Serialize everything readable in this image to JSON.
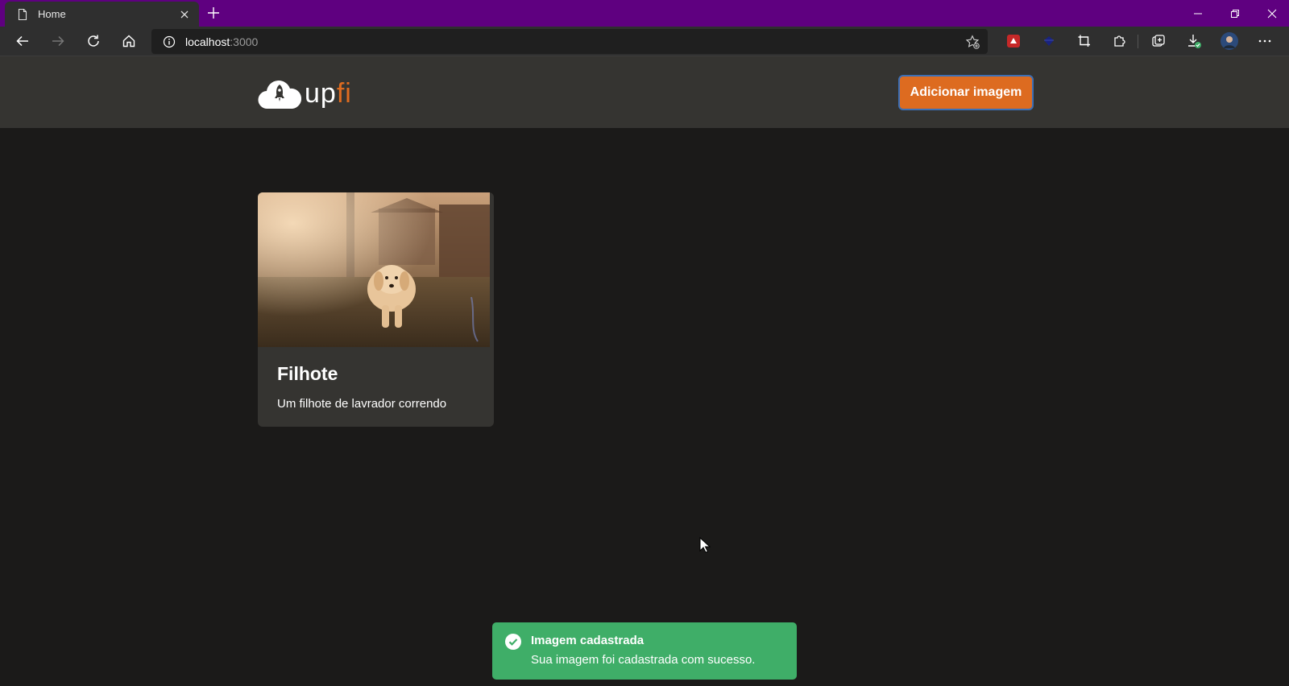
{
  "browser": {
    "tab_title": "Home",
    "address": {
      "host": "localhost",
      "port": ":3000"
    }
  },
  "header": {
    "logo": {
      "part1": "up",
      "part2": "fi"
    },
    "add_button_label": "Adicionar imagem"
  },
  "cards": [
    {
      "title": "Filhote",
      "description": "Um filhote de lavrador correndo"
    }
  ],
  "toast": {
    "title": "Imagem cadastrada",
    "description": "Sua imagem foi cadastrada com sucesso."
  },
  "colors": {
    "brand_orange": "#dd6b20",
    "toast_green": "#3fae68",
    "page_bg": "#1b1a19",
    "header_bg": "#353431",
    "tabbar_purple": "#5f0080"
  }
}
